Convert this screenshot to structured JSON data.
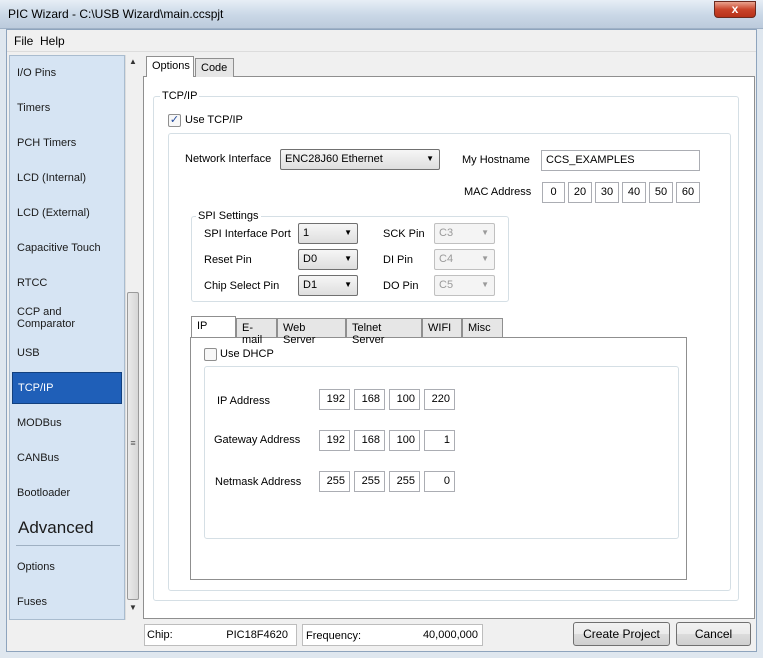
{
  "window": {
    "title": "PIC Wizard - C:\\USB Wizard\\main.ccspjt",
    "close_glyph": "x"
  },
  "menu": [
    {
      "label": "File"
    },
    {
      "label": "Help"
    }
  ],
  "sidebar": {
    "items": [
      {
        "label": "I/O Pins"
      },
      {
        "label": "Timers"
      },
      {
        "label": "PCH Timers"
      },
      {
        "label": "LCD (Internal)"
      },
      {
        "label": "LCD (External)"
      },
      {
        "label": "Capacitive Touch"
      },
      {
        "label": "RTCC"
      },
      {
        "label": "CCP and Comparator"
      },
      {
        "label": "USB"
      },
      {
        "label": "TCP/IP",
        "selected": true
      },
      {
        "label": "MODBus"
      },
      {
        "label": "CANBus"
      },
      {
        "label": "Bootloader"
      }
    ],
    "advanced_heading": "Advanced",
    "advanced_items": [
      {
        "label": "Options"
      },
      {
        "label": "Fuses"
      }
    ],
    "scroll": {
      "up": "▲",
      "down": "▼",
      "grip": "≡"
    }
  },
  "tabs": [
    {
      "label": "Options",
      "active": true
    },
    {
      "label": "Code"
    }
  ],
  "tcpip": {
    "group_title": "TCP/IP",
    "use_tcpip": {
      "label": "Use TCP/IP",
      "checked": true,
      "mark": "✓"
    },
    "network_interface": {
      "label": "Network Interface",
      "value": "ENC28J60 Ethernet",
      "arrow": "▼"
    },
    "hostname": {
      "label": "My Hostname",
      "value": "CCS_EXAMPLES"
    },
    "mac": {
      "label": "MAC Address",
      "octets": [
        "0",
        "20",
        "30",
        "40",
        "50",
        "60"
      ]
    },
    "spi": {
      "title": "SPI Settings",
      "interface_port": {
        "label": "SPI Interface Port",
        "value": "1"
      },
      "reset_pin": {
        "label": "Reset Pin",
        "value": "D0"
      },
      "chip_select_pin": {
        "label": "Chip Select Pin",
        "value": "D1"
      },
      "sck_pin": {
        "label": "SCK Pin",
        "value": "C3"
      },
      "di_pin": {
        "label": "DI Pin",
        "value": "C4"
      },
      "do_pin": {
        "label": "DO Pin",
        "value": "C5"
      }
    },
    "subtabs": [
      {
        "label": "IP",
        "active": true
      },
      {
        "label": "E-mail"
      },
      {
        "label": "Web Server"
      },
      {
        "label": "Telnet Server"
      },
      {
        "label": "WIFI"
      },
      {
        "label": "Misc"
      }
    ],
    "ip": {
      "use_dhcp": {
        "label": "Use DHCP",
        "checked": false
      },
      "ip_address": {
        "label": "IP Address",
        "octets": [
          "192",
          "168",
          "100",
          "220"
        ]
      },
      "gateway_address": {
        "label": "Gateway Address",
        "octets": [
          "192",
          "168",
          "100",
          "1"
        ]
      },
      "netmask_address": {
        "label": "Netmask Address",
        "octets": [
          "255",
          "255",
          "255",
          "0"
        ]
      }
    }
  },
  "status": {
    "chip": {
      "label": "Chip:",
      "value": "PIC18F4620"
    },
    "frequency": {
      "label": "Frequency:",
      "value": "40,000,000"
    }
  },
  "buttons": {
    "create": "Create Project",
    "cancel": "Cancel"
  }
}
